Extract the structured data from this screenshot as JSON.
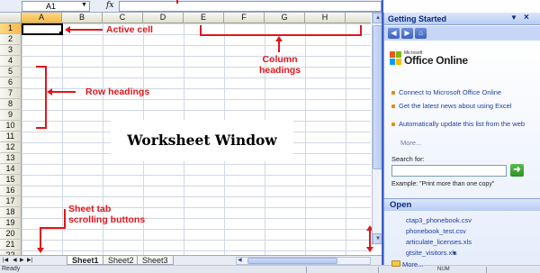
{
  "formula_bar": {
    "name_box_value": "A1",
    "fx_label": "fx"
  },
  "grid": {
    "columns": [
      "A",
      "B",
      "C",
      "D",
      "E",
      "F",
      "G",
      "H"
    ],
    "rows": [
      "1",
      "2",
      "3",
      "4",
      "5",
      "6",
      "7",
      "8",
      "9",
      "10",
      "11",
      "12",
      "13",
      "14",
      "15",
      "16",
      "17",
      "18",
      "19",
      "20",
      "21",
      "22"
    ],
    "active_cell": "A1"
  },
  "annotations": {
    "active_cell": "Active cell",
    "column_headings_line1": "Column",
    "column_headings_line2": "headings",
    "row_headings": "Row headings",
    "sheet_tab_line1": "Sheet tab",
    "sheet_tab_line2": "scrolling buttons",
    "worksheet_window": "Worksheet Window"
  },
  "sheet_tabs": [
    "Sheet1",
    "Sheet2",
    "Sheet3"
  ],
  "active_sheet": "Sheet1",
  "status_bar": {
    "status_text": "Ready",
    "num_indicator": "NUM"
  },
  "task_pane": {
    "title": "Getting Started",
    "logo_small": "Microsoft",
    "logo_text": "Office Online",
    "links": [
      "Connect to Microsoft Office Online",
      "Get the latest news about using Excel",
      "Automatically update this list from the web"
    ],
    "more_label": "More...",
    "search_label": "Search for:",
    "search_value": "",
    "search_example": "Example:  \"Print more than one copy\"",
    "open_title": "Open",
    "recent_files": [
      "ctap3_phonebook.csv",
      "phonebook_test.csv",
      "articulate_licenses.xls",
      "gtsite_visitors.xls"
    ],
    "open_more_label": "More..."
  },
  "colors": {
    "annotation_red": "#e0161b",
    "pane_blue": "#0c2a7d",
    "link_blue": "#1d3f9e",
    "active_header": "#f6b94a"
  }
}
